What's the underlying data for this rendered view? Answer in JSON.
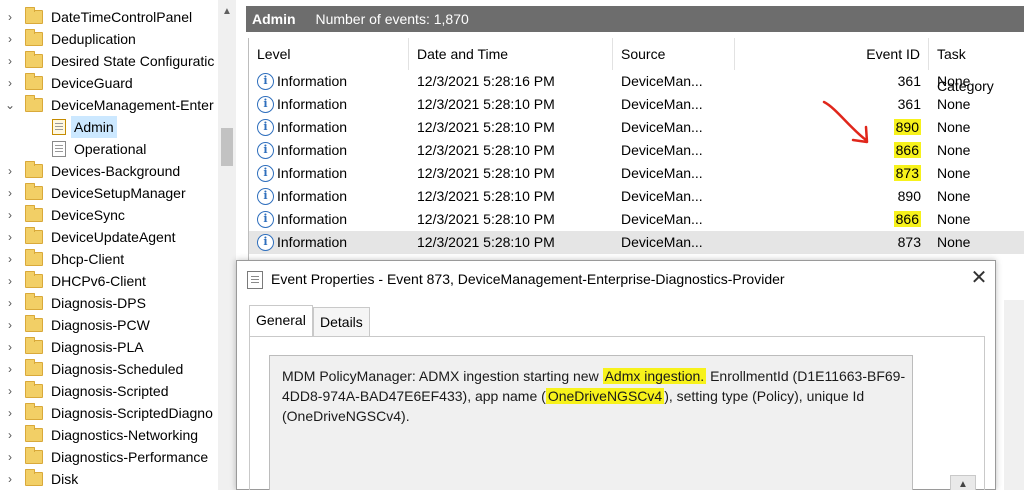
{
  "tree": {
    "items": [
      {
        "label": "DateTimeControlPanel",
        "kind": "folder"
      },
      {
        "label": "Deduplication",
        "kind": "folder"
      },
      {
        "label": "Desired State Configuratic",
        "kind": "folder"
      },
      {
        "label": "DeviceGuard",
        "kind": "folder"
      },
      {
        "label": "DeviceManagement-Enter",
        "kind": "folder",
        "expanded": true
      },
      {
        "label": "Admin",
        "kind": "log",
        "selected": true
      },
      {
        "label": "Operational",
        "kind": "log"
      },
      {
        "label": "Devices-Background",
        "kind": "folder"
      },
      {
        "label": "DeviceSetupManager",
        "kind": "folder"
      },
      {
        "label": "DeviceSync",
        "kind": "folder"
      },
      {
        "label": "DeviceUpdateAgent",
        "kind": "folder"
      },
      {
        "label": "Dhcp-Client",
        "kind": "folder"
      },
      {
        "label": "DHCPv6-Client",
        "kind": "folder"
      },
      {
        "label": "Diagnosis-DPS",
        "kind": "folder"
      },
      {
        "label": "Diagnosis-PCW",
        "kind": "folder"
      },
      {
        "label": "Diagnosis-PLA",
        "kind": "folder"
      },
      {
        "label": "Diagnosis-Scheduled",
        "kind": "folder"
      },
      {
        "label": "Diagnosis-Scripted",
        "kind": "folder"
      },
      {
        "label": "Diagnosis-ScriptedDiagno",
        "kind": "folder"
      },
      {
        "label": "Diagnostics-Networking",
        "kind": "folder"
      },
      {
        "label": "Diagnostics-Performance",
        "kind": "folder"
      },
      {
        "label": "Disk",
        "kind": "folder"
      }
    ]
  },
  "events_header": {
    "title": "Admin",
    "count_text": "Number of events: 1,870"
  },
  "columns": {
    "level": "Level",
    "datetime": "Date and Time",
    "source": "Source",
    "event_id": "Event ID",
    "task": "Task Category"
  },
  "rows": [
    {
      "level": "Information",
      "datetime": "12/3/2021 5:28:16 PM",
      "source": "DeviceMan...",
      "event_id": "361",
      "task": "None",
      "highlight": false
    },
    {
      "level": "Information",
      "datetime": "12/3/2021 5:28:10 PM",
      "source": "DeviceMan...",
      "event_id": "361",
      "task": "None",
      "highlight": false
    },
    {
      "level": "Information",
      "datetime": "12/3/2021 5:28:10 PM",
      "source": "DeviceMan...",
      "event_id": "890",
      "task": "None",
      "highlight": true
    },
    {
      "level": "Information",
      "datetime": "12/3/2021 5:28:10 PM",
      "source": "DeviceMan...",
      "event_id": "866",
      "task": "None",
      "highlight": true
    },
    {
      "level": "Information",
      "datetime": "12/3/2021 5:28:10 PM",
      "source": "DeviceMan...",
      "event_id": "873",
      "task": "None",
      "highlight": true
    },
    {
      "level": "Information",
      "datetime": "12/3/2021 5:28:10 PM",
      "source": "DeviceMan...",
      "event_id": "890",
      "task": "None",
      "highlight": false
    },
    {
      "level": "Information",
      "datetime": "12/3/2021 5:28:10 PM",
      "source": "DeviceMan...",
      "event_id": "866",
      "task": "None",
      "highlight": true
    },
    {
      "level": "Information",
      "datetime": "12/3/2021 5:28:10 PM",
      "source": "DeviceMan...",
      "event_id": "873",
      "task": "None",
      "highlight": false,
      "selected": true
    }
  ],
  "dialog": {
    "title": "Event Properties - Event 873, DeviceManagement-Enterprise-Diagnostics-Provider",
    "close": "✕",
    "tabs": [
      "General",
      "Details"
    ],
    "message_parts": {
      "p1": "MDM PolicyManager: ADMX ingestion starting new ",
      "hl1": "Admx ingestion.",
      "p2": " EnrollmentId (D1E11663-BF69-4DD8-974A-BAD47E6EF433), app name (",
      "hl2": "OneDriveNGSCv4",
      "p3": "), setting type (Policy), unique Id (OneDriveNGSCv4)."
    }
  },
  "colors": {
    "header_bg": "#6d6d6d",
    "highlight": "#f7f21b",
    "annotation_arrow": "#e0261b",
    "selection": "#cce8ff"
  }
}
